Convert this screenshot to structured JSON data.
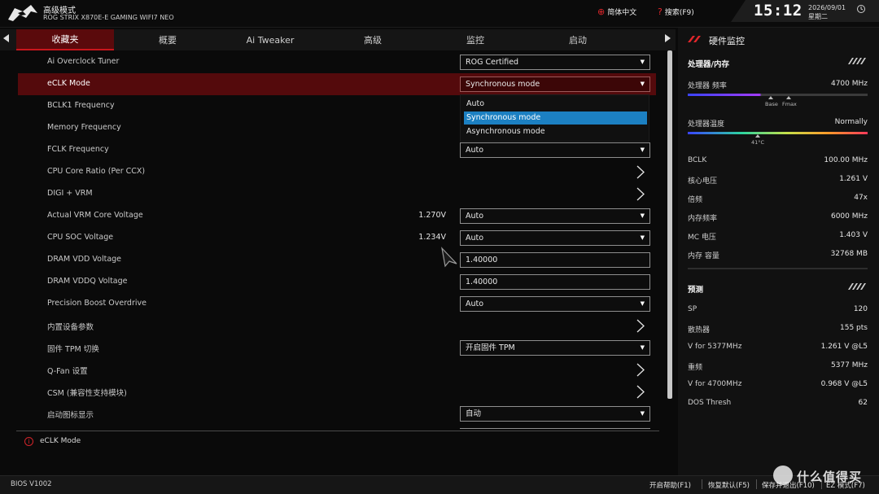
{
  "header": {
    "mode_title": "高级模式",
    "board_name": "ROG STRIX X870E-E GAMING WIFI7 NEO",
    "language": "简体中文",
    "search": "搜索(F9)",
    "time": "15:12",
    "date": "2026/09/01",
    "weekday": "星期二"
  },
  "tabs": [
    "收藏夹",
    "概要",
    "Ai Tweaker",
    "高级",
    "监控",
    "启动"
  ],
  "active_tab": "收藏夹",
  "settings": [
    {
      "label": "Ai Overclock Tuner",
      "control": "select",
      "value": "ROG Certified"
    },
    {
      "label": "eCLK Mode",
      "control": "select",
      "value": "Synchronous mode",
      "highlighted": true
    },
    {
      "label": "BCLK1 Frequency",
      "control": "none"
    },
    {
      "label": "Memory Frequency",
      "control": "none"
    },
    {
      "label": "FCLK Frequency",
      "control": "select",
      "value": "Auto"
    },
    {
      "label": "CPU Core Ratio (Per CCX)",
      "control": "submenu"
    },
    {
      "label": "DIGI + VRM",
      "control": "submenu"
    },
    {
      "label": "Actual VRM Core Voltage",
      "control": "select",
      "value": "Auto",
      "current": "1.270V"
    },
    {
      "label": "CPU SOC Voltage",
      "control": "select",
      "value": "Auto",
      "current": "1.234V"
    },
    {
      "label": "DRAM VDD Voltage",
      "control": "input",
      "value": "1.40000"
    },
    {
      "label": "DRAM VDDQ Voltage",
      "control": "input",
      "value": "1.40000"
    },
    {
      "label": "Precision Boost Overdrive",
      "control": "select",
      "value": "Auto"
    },
    {
      "label": "内置设备参数",
      "control": "submenu"
    },
    {
      "label": "固件 TPM 切换",
      "control": "select",
      "value": "开启固件 TPM"
    },
    {
      "label": "Q-Fan 设置",
      "control": "submenu"
    },
    {
      "label": "CSM (兼容性支持模块)",
      "control": "submenu"
    },
    {
      "label": "启动图标显示",
      "control": "select",
      "value": "自动"
    }
  ],
  "dropdown": {
    "options": [
      "Auto",
      "Synchronous mode",
      "Asynchronous mode"
    ],
    "selected": "Synchronous mode"
  },
  "help_text": "eCLK Mode",
  "hardware_monitor": {
    "title": "硬件监控",
    "cpu_section_title": "处理器/内存",
    "cpu_freq_label": "处理器 频率",
    "cpu_freq_value": "4700 MHz",
    "cpu_freq_ticks": [
      "Base",
      "Fmax"
    ],
    "cpu_temp_label": "处理器温度",
    "cpu_temp_value": "Normally",
    "cpu_temp_tick": "41°C",
    "stats": [
      {
        "label": "BCLK",
        "value": "100.00 MHz"
      },
      {
        "label": "核心电压",
        "value": "1.261 V"
      },
      {
        "label": "倍频",
        "value": "47x"
      },
      {
        "label": "内存频率",
        "value": "6000 MHz"
      },
      {
        "label": "MC 电压",
        "value": "1.403 V"
      },
      {
        "label": "内存 容量",
        "value": "32768 MB"
      }
    ],
    "prediction_title": "预测",
    "prediction": [
      {
        "label": "SP",
        "value": "120"
      },
      {
        "label": "散热器",
        "value": "155 pts"
      },
      {
        "label": "V for 5377MHz",
        "value": "1.261 V @L5"
      },
      {
        "label": "重频",
        "value": "5377 MHz"
      },
      {
        "label": "V for 4700MHz",
        "value": "0.968 V @L5"
      },
      {
        "label": "DOS Thresh",
        "value": "62"
      }
    ]
  },
  "footer": {
    "bios_version": "BIOS V1002",
    "items": [
      "开启帮助(F1)",
      "恢复默认(F5)",
      "保存并退出(F10)",
      "EZ 模式(F7)"
    ]
  },
  "watermark": "什么值得买",
  "colors": {
    "accent": "#c8161c",
    "highlight_row": "#540a0c",
    "dropdown_selected": "#1c80c2"
  }
}
